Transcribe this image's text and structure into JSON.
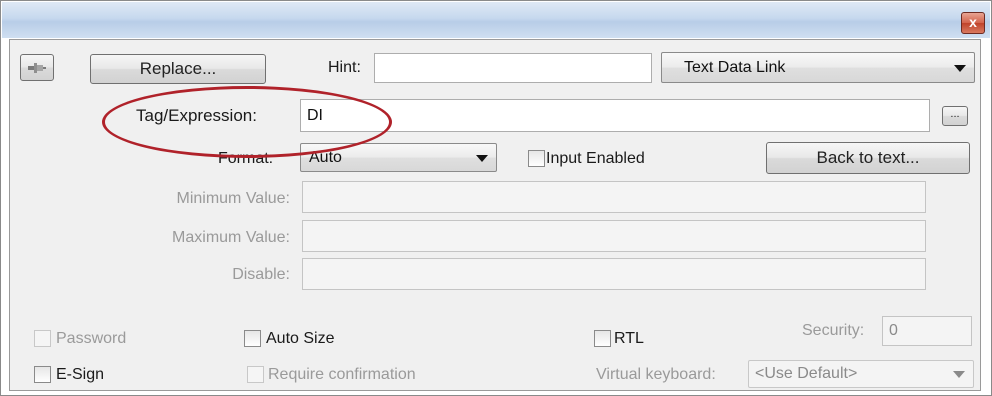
{
  "toolbar": {
    "pin_icon": "pin-icon",
    "replace_label": "Replace...",
    "hint_label": "Hint:",
    "hint_value": "",
    "link_type_selected": "Text Data Link"
  },
  "tag_expression": {
    "label": "Tag/Expression:",
    "value": "DI",
    "browse_label": "..."
  },
  "format": {
    "label": "Format:",
    "selected": "Auto",
    "input_enabled_label": "Input Enabled",
    "input_enabled_checked": false,
    "back_to_text_label": "Back to text..."
  },
  "fields": {
    "minimum_label": "Minimum Value:",
    "minimum_value": "",
    "maximum_label": "Maximum Value:",
    "maximum_value": "",
    "disable_label": "Disable:",
    "disable_value": ""
  },
  "options": {
    "password_label": "Password",
    "auto_size_label": "Auto Size",
    "rtl_label": "RTL",
    "security_label": "Security:",
    "security_value": "0",
    "esign_label": "E-Sign",
    "require_confirmation_label": "Require confirmation",
    "virtual_keyboard_label": "Virtual keyboard:",
    "virtual_keyboard_selected": "<Use Default>"
  },
  "window": {
    "close_icon": "close-icon",
    "close_glyph": "x"
  },
  "colors": {
    "highlight_ellipse": "#b0222a",
    "close_button": "#c0432a"
  }
}
